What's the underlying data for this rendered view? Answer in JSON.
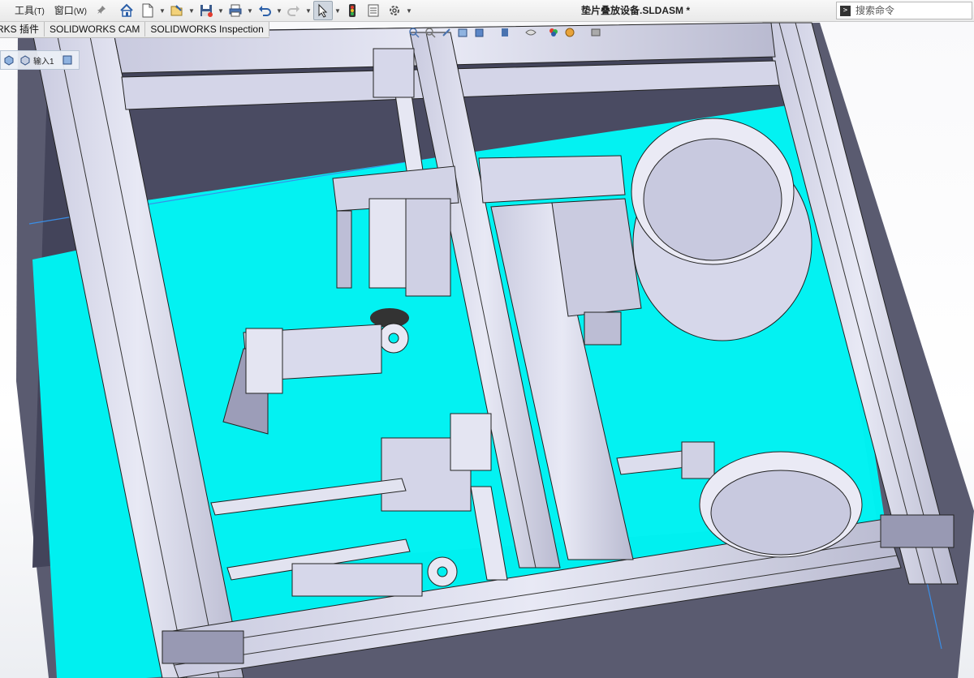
{
  "menu": {
    "items": [
      {
        "label": "工具",
        "accel": "(T)"
      },
      {
        "label": "窗口",
        "accel": "(W)"
      }
    ]
  },
  "toolbar": {
    "icons": [
      "home-icon",
      "new-document-icon",
      "open-folder-icon",
      "save-icon",
      "print-icon",
      "undo-icon",
      "redo-icon",
      "select-pointer-icon",
      "traffic-light-icon",
      "file-properties-icon",
      "options-gear-icon"
    ]
  },
  "document": {
    "title": "垫片叠放设备.SLDASM *"
  },
  "search": {
    "placeholder": "搜索命令"
  },
  "command_tabs": [
    {
      "label": "RKS 插件"
    },
    {
      "label": "SOLIDWORKS CAM"
    },
    {
      "label": "SOLIDWORKS Inspection"
    }
  ],
  "breadcrumb": {
    "label": "输入1"
  },
  "colors": {
    "background": "#ffffff",
    "frame": "#d8d9ea",
    "frame_shadow": "#4d4e63",
    "cyan_plate": "#00f0f0",
    "selection_edge": "#3a8ee6"
  }
}
